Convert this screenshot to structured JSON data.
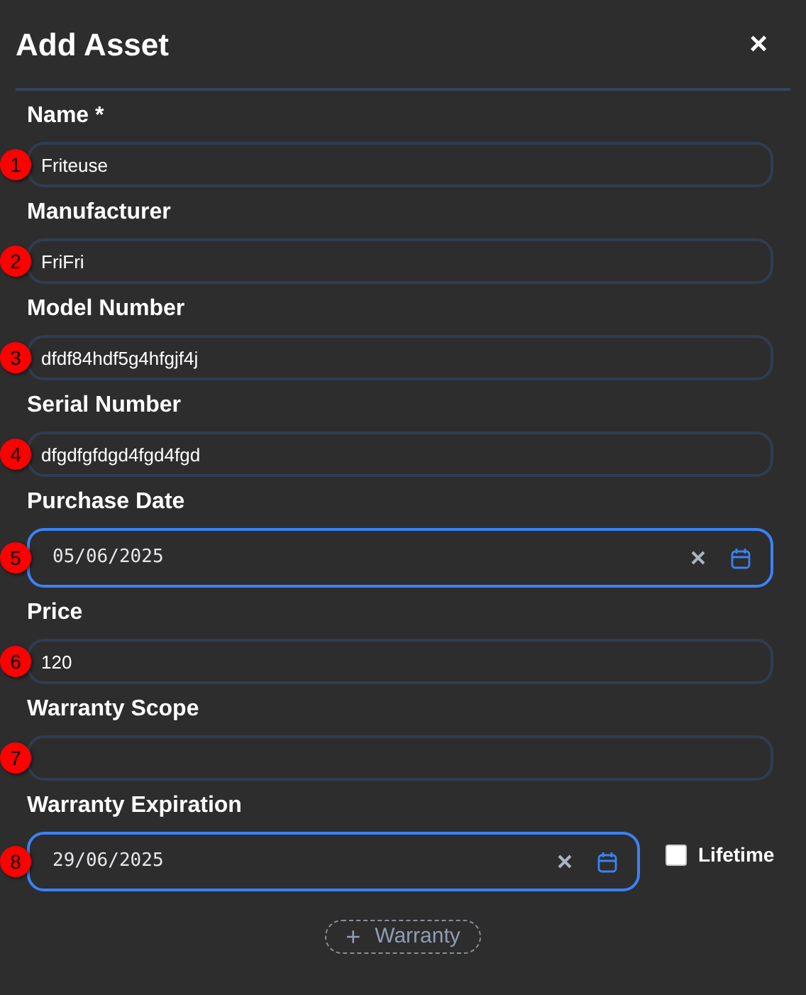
{
  "dialog": {
    "title": "Add Asset",
    "close": "×"
  },
  "fields": [
    {
      "label": "Name *",
      "kind": "text",
      "value": "Friteuse",
      "marker": "1"
    },
    {
      "label": "Manufacturer",
      "kind": "text",
      "value": "FriFri",
      "marker": "2"
    },
    {
      "label": "Model Number",
      "kind": "text",
      "value": "dfdf84hdf5g4hfgjf4j",
      "marker": "3"
    },
    {
      "label": "Serial Number",
      "kind": "text",
      "value": "dfgdfgfdgd4fgd4fgd",
      "marker": "4"
    },
    {
      "label": "Purchase Date",
      "kind": "date",
      "value": "05/06/2025",
      "marker": "5"
    },
    {
      "label": "Price",
      "kind": "text",
      "value": "120",
      "marker": "6"
    },
    {
      "label": "Warranty Scope",
      "kind": "text",
      "marker": "7"
    },
    {
      "label": "Warranty Expiration",
      "kind": "date",
      "value": "29/06/2025",
      "marker": "8",
      "checkbox": {
        "label": "Lifetime",
        "checked": false
      }
    }
  ],
  "add_button": {
    "icon": "+",
    "label": "Warranty"
  }
}
